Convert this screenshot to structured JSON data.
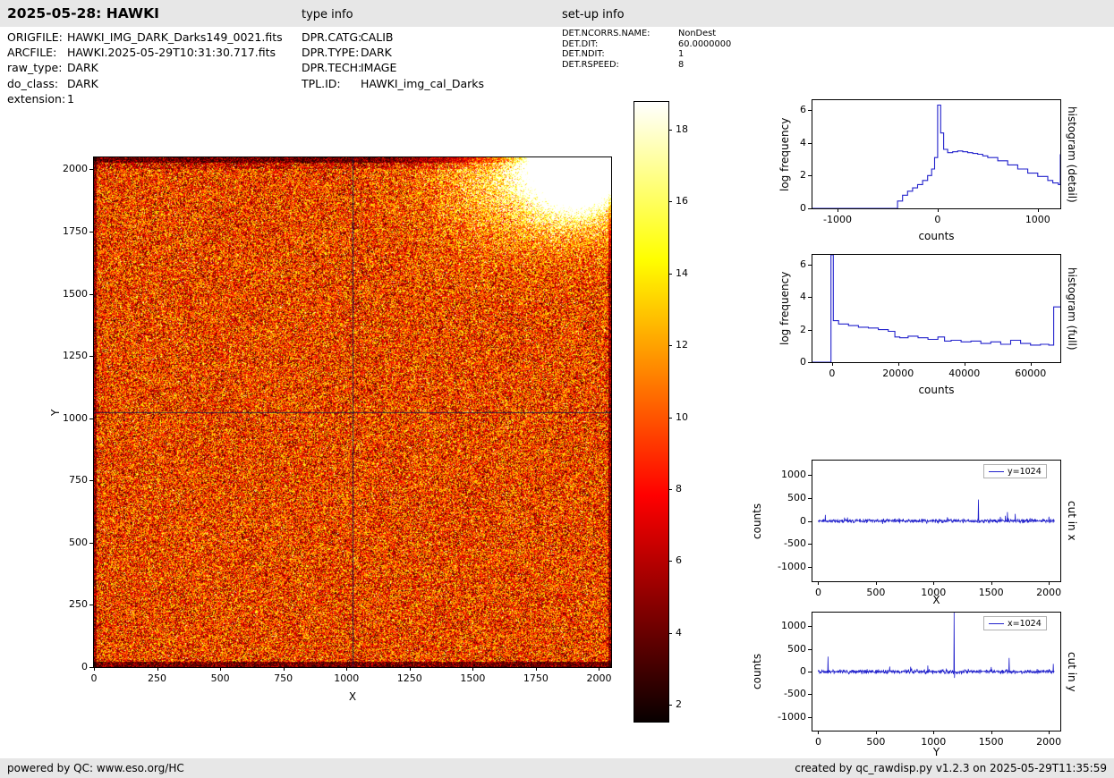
{
  "header": {
    "title": "2025-05-28: HAWKI",
    "type_info_label": "type info",
    "setup_info_label": "set-up info"
  },
  "file_info": {
    "rows": [
      {
        "label": "ORIGFILE:",
        "value": "HAWKI_IMG_DARK_Darks149_0021.fits"
      },
      {
        "label": "ARCFILE:",
        "value": "HAWKI.2025-05-29T10:31:30.717.fits"
      },
      {
        "label": "raw_type:",
        "value": "DARK"
      },
      {
        "label": "do_class:",
        "value": "DARK"
      },
      {
        "label": "extension:",
        "value": "1"
      }
    ]
  },
  "type_info": {
    "rows": [
      {
        "label": "DPR.CATG:",
        "value": "CALIB"
      },
      {
        "label": "DPR.TYPE:",
        "value": "DARK"
      },
      {
        "label": "DPR.TECH:",
        "value": "IMAGE"
      },
      {
        "label": "TPL.ID:",
        "value": "HAWKI_img_cal_Darks"
      }
    ]
  },
  "setup_info": {
    "rows": [
      {
        "label": "DET.NCORRS.NAME:",
        "value": "NonDest"
      },
      {
        "label": "DET.DIT:",
        "value": "60.0000000"
      },
      {
        "label": "DET.NDIT:",
        "value": "1"
      },
      {
        "label": "DET.RSPEED:",
        "value": "8"
      }
    ]
  },
  "footer": {
    "left": "powered by QC: www.eso.org/HC",
    "right": "created by qc_rawdisp.py v1.2.3 on 2025-05-29T11:35:59"
  },
  "chart_data": [
    {
      "id": "dark-frame",
      "type": "heatmap",
      "xlabel": "X",
      "ylabel": "Y",
      "xlim": [
        0,
        2048
      ],
      "ylim": [
        0,
        2048
      ],
      "xticks": [
        0,
        250,
        500,
        750,
        1000,
        1250,
        1500,
        1750,
        2000
      ],
      "yticks": [
        0,
        250,
        500,
        750,
        1000,
        1250,
        1500,
        1750,
        2000
      ],
      "colormap": "hot",
      "crosshair": {
        "x": 1024,
        "y": 1024
      },
      "description": "2048x2048 raw dark frame in hot colormap: speckled orange/red noise, dark noisy border rows, saturated white blob in top-right corner, crosshair cut lines at x=1024 and y=1024"
    },
    {
      "id": "colorbar",
      "type": "colorbar",
      "colormap": "hot",
      "vmin": 1.5,
      "vmax": 18.8,
      "ticks": [
        2,
        4,
        6,
        8,
        10,
        12,
        14,
        16,
        18
      ]
    },
    {
      "id": "hist-detail",
      "type": "line",
      "style": "step",
      "xlabel": "counts",
      "ylabel": "log frequency",
      "right_label": "histogram (detail)",
      "color": "#2222cc",
      "xlim": [
        -1250,
        1225
      ],
      "ylim": [
        0,
        6.6
      ],
      "xticks": [
        -1000,
        0,
        1000
      ],
      "yticks": [
        0,
        2,
        4,
        6
      ],
      "x": [
        -1250,
        -450,
        -400,
        -350,
        -300,
        -250,
        -200,
        -150,
        -100,
        -60,
        -30,
        0,
        30,
        60,
        100,
        150,
        200,
        250,
        300,
        350,
        400,
        450,
        500,
        600,
        700,
        800,
        900,
        1000,
        1100,
        1150,
        1205,
        1225
      ],
      "y": [
        0,
        0,
        0.45,
        0.8,
        1.05,
        1.25,
        1.45,
        1.7,
        2.0,
        2.4,
        3.1,
        6.3,
        4.6,
        3.6,
        3.4,
        3.45,
        3.5,
        3.45,
        3.4,
        3.35,
        3.3,
        3.2,
        3.1,
        2.9,
        2.65,
        2.4,
        2.15,
        1.95,
        1.7,
        1.55,
        1.45,
        3.3
      ]
    },
    {
      "id": "hist-full",
      "type": "line",
      "style": "step",
      "xlabel": "counts",
      "ylabel": "log frequency",
      "right_label": "histogram (full)",
      "color": "#2222cc",
      "xlim": [
        -5900,
        69000
      ],
      "ylim": [
        0,
        6.6
      ],
      "xticks": [
        0,
        20000,
        40000,
        60000
      ],
      "yticks": [
        0,
        2,
        4,
        6
      ],
      "x": [
        -5900,
        -800,
        -300,
        400,
        2000,
        5000,
        8000,
        11000,
        14000,
        17000,
        19000,
        20500,
        23000,
        26000,
        29000,
        32000,
        34000,
        36000,
        39000,
        42000,
        45000,
        48000,
        51000,
        54000,
        57000,
        60000,
        63000,
        65500,
        67000,
        69000
      ],
      "y": [
        0,
        0,
        6.6,
        2.55,
        2.35,
        2.25,
        2.15,
        2.1,
        2.0,
        1.9,
        1.55,
        1.5,
        1.6,
        1.5,
        1.4,
        1.55,
        1.3,
        1.35,
        1.25,
        1.3,
        1.15,
        1.25,
        1.1,
        1.35,
        1.15,
        1.05,
        1.1,
        1.05,
        3.4,
        3.4
      ]
    },
    {
      "id": "cut-x",
      "type": "line",
      "legend": "y=1024",
      "xlabel": "X",
      "ylabel": "counts",
      "right_label": "cut in x",
      "color": "#2222cc",
      "xlim": [
        -50,
        2100
      ],
      "ylim": [
        -1300,
        1300
      ],
      "xticks": [
        0,
        500,
        1000,
        1500,
        2000
      ],
      "yticks": [
        -1000,
        -500,
        0,
        500,
        1000
      ],
      "noise_sd": 35,
      "spikes": [
        {
          "x": 60,
          "v": 130
        },
        {
          "x": 1390,
          "v": 460
        },
        {
          "x": 1640,
          "v": 190
        },
        {
          "x": 1710,
          "v": 150
        },
        {
          "x": 2000,
          "v": 90
        }
      ]
    },
    {
      "id": "cut-y",
      "type": "line",
      "legend": "x=1024",
      "xlabel": "Y",
      "ylabel": "counts",
      "right_label": "cut in y",
      "color": "#2222cc",
      "xlim": [
        -50,
        2100
      ],
      "ylim": [
        -1300,
        1300
      ],
      "xticks": [
        0,
        500,
        1000,
        1500,
        2000
      ],
      "yticks": [
        -1000,
        -500,
        0,
        500,
        1000
      ],
      "noise_sd": 40,
      "spikes": [
        {
          "x": 85,
          "v": 330
        },
        {
          "x": 620,
          "v": 110
        },
        {
          "x": 1180,
          "v": 1400
        },
        {
          "x": 1500,
          "v": 100
        },
        {
          "x": 1655,
          "v": 300
        },
        {
          "x": 2040,
          "v": 170
        }
      ]
    }
  ]
}
